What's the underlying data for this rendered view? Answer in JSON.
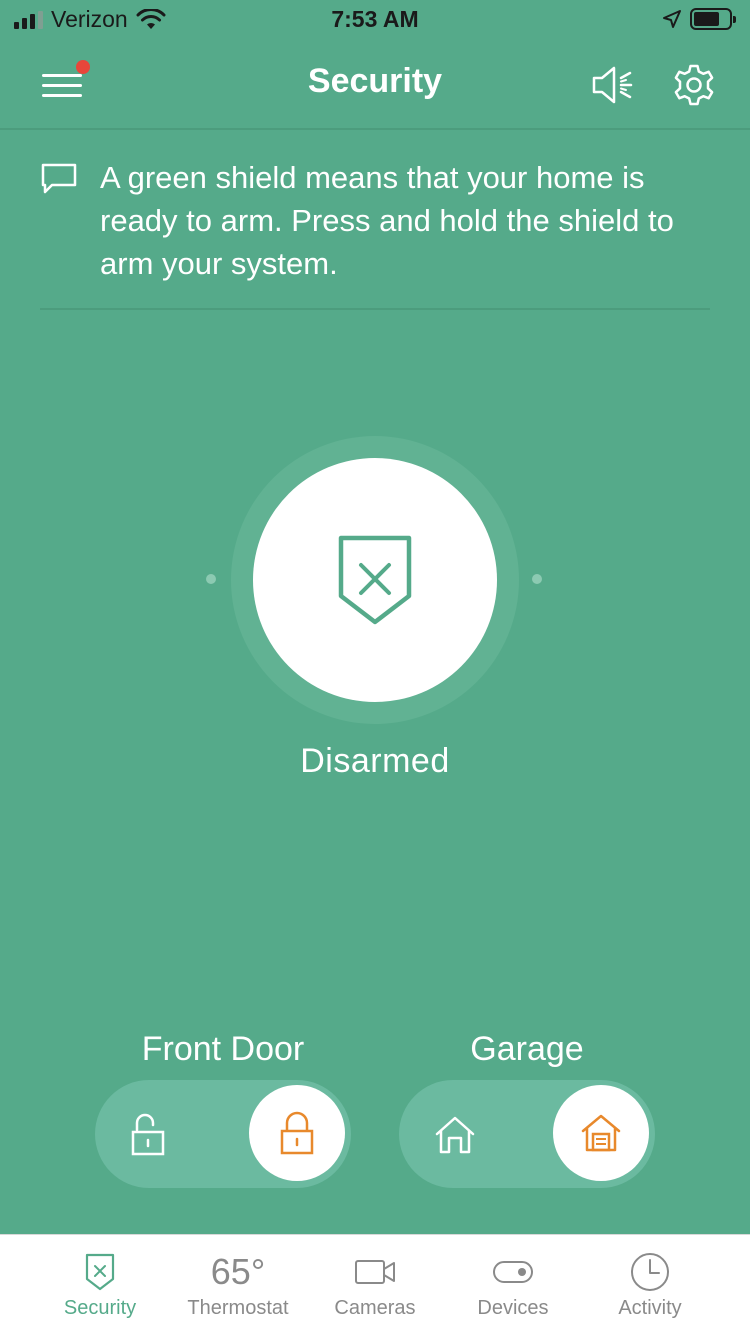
{
  "status_bar": {
    "carrier": "Verizon",
    "time": "7:53 AM",
    "signal_bars": 3
  },
  "header": {
    "title": "Security",
    "menu_has_notification": true,
    "menu_icon": "hamburger-icon",
    "speaker_icon": "speaker-icon",
    "settings_icon": "gear-icon"
  },
  "message": {
    "icon": "chat-bubble-icon",
    "text": "A green shield means that your home is ready to arm. Press and hold the shield to arm your system."
  },
  "security": {
    "status": "Disarmed",
    "icon": "shield-x-icon"
  },
  "toggles": [
    {
      "title": "Front Door",
      "off_icon": "unlocked-icon",
      "on_icon": "locked-icon",
      "state": "locked"
    },
    {
      "title": "Garage",
      "off_icon": "garage-open-icon",
      "on_icon": "garage-closed-icon",
      "state": "closed"
    }
  ],
  "tabs": [
    {
      "label": "Security",
      "icon": "shield-x-icon",
      "active": true
    },
    {
      "label": "Thermostat",
      "icon_text": "65°",
      "active": false
    },
    {
      "label": "Cameras",
      "icon": "camera-icon",
      "active": false
    },
    {
      "label": "Devices",
      "icon": "toggle-icon",
      "active": false
    },
    {
      "label": "Activity",
      "icon": "clock-icon",
      "active": false
    }
  ],
  "colors": {
    "background": "#55aa8a",
    "accent_orange": "#e8892c",
    "notification_red": "#e8463a",
    "tab_active": "#55aa8a",
    "tab_inactive": "#8a8a8a"
  }
}
